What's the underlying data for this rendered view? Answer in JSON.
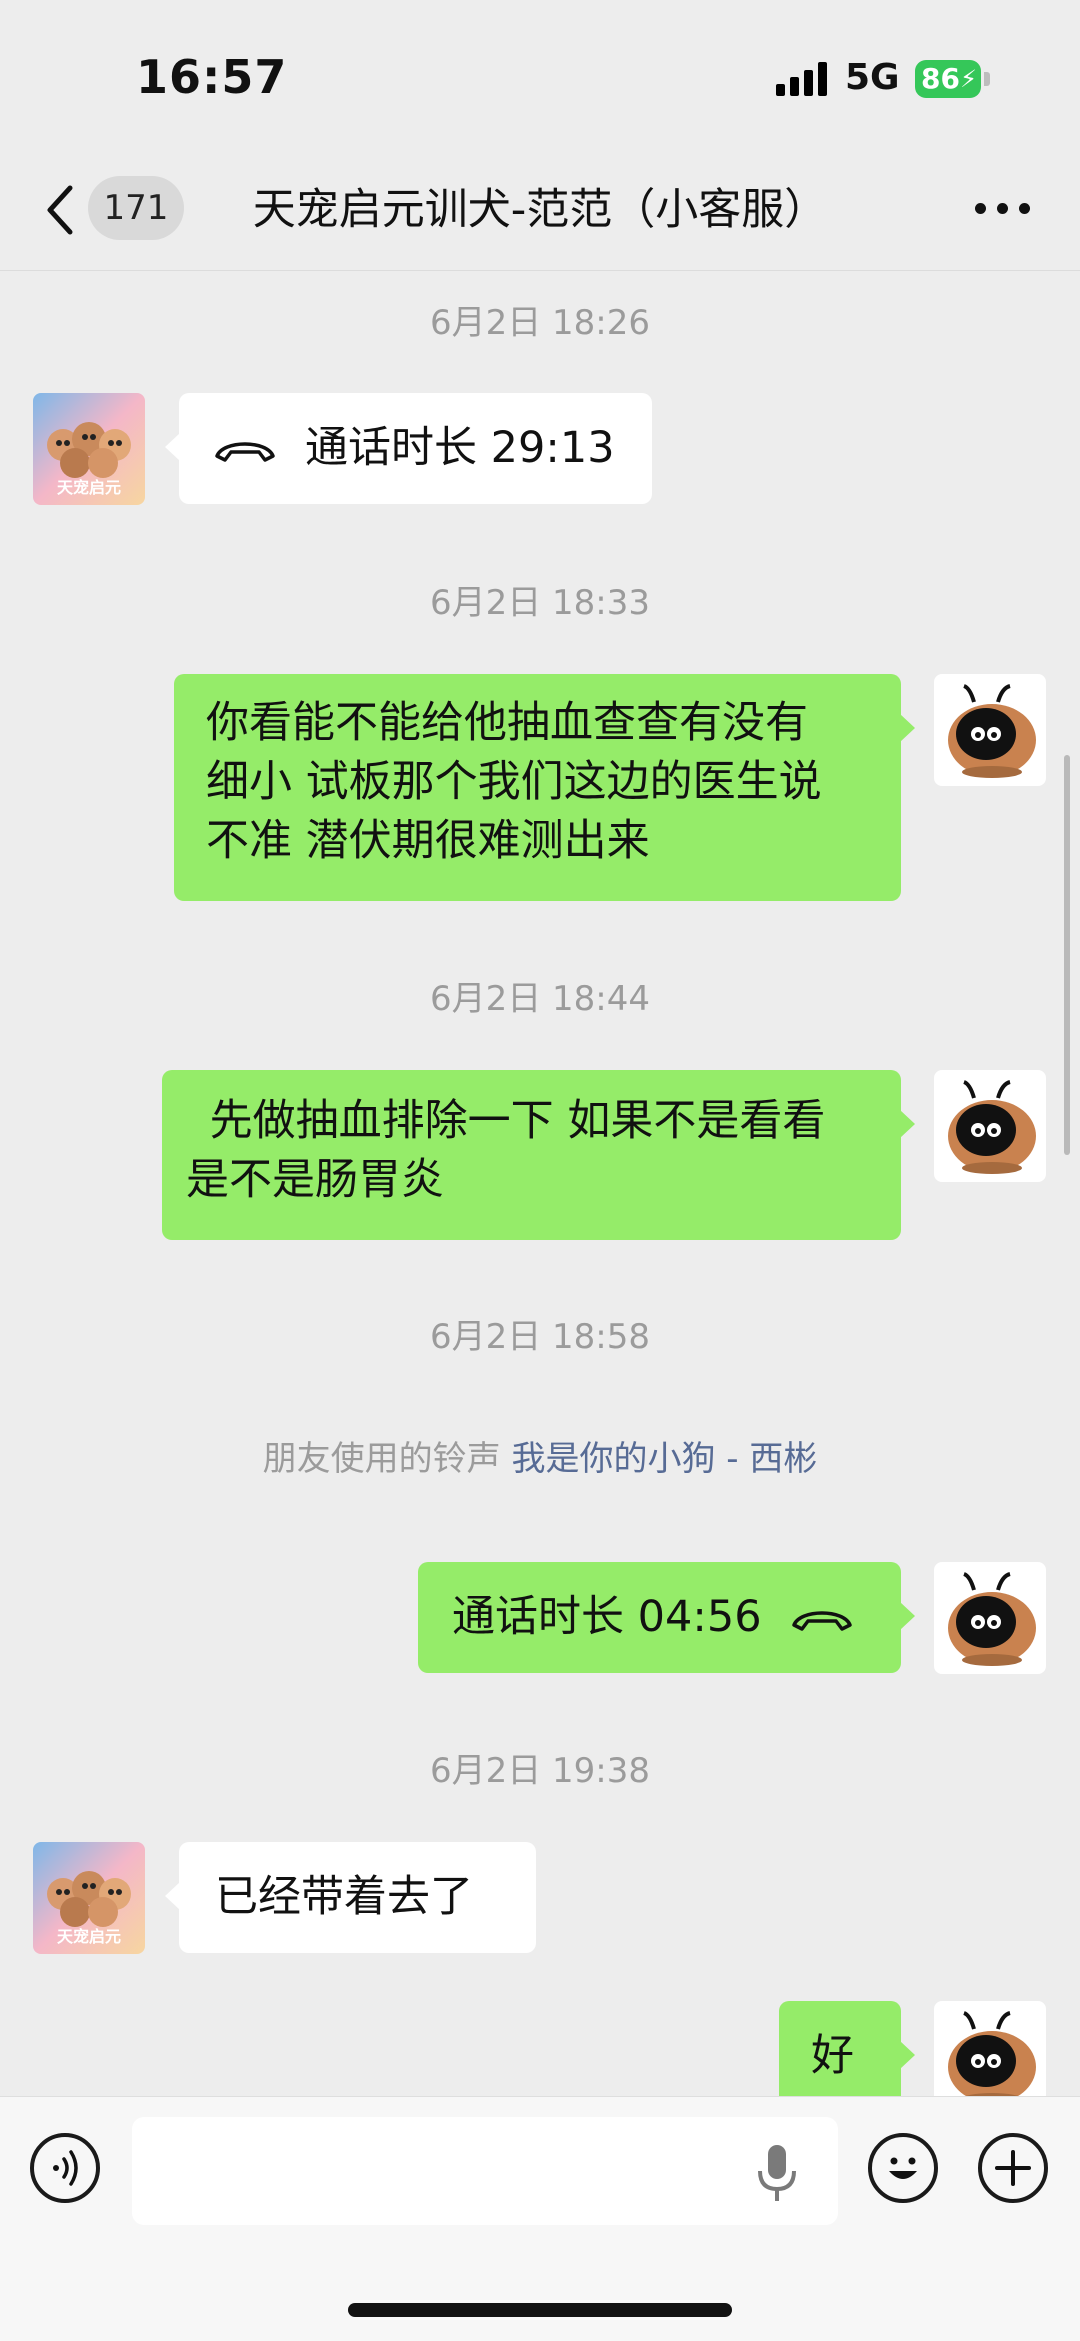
{
  "status_bar": {
    "time": "16:57",
    "network": "5G",
    "battery": "86"
  },
  "nav": {
    "back_count": "171",
    "title": "天宠启元训犬-范范（小客服）"
  },
  "contact_avatar_text": "天宠启元",
  "messages": [
    {
      "type": "timestamp",
      "text": "6月2日 18:26"
    },
    {
      "type": "call",
      "from": "them",
      "text": "通话时长 29:13"
    },
    {
      "type": "timestamp",
      "text": "6月2日 18:33"
    },
    {
      "type": "text",
      "from": "me",
      "lines": [
        "你看能不能给他抽血查查有没有",
        "细小 试板那个我们这边的医生说",
        "不准 潜伏期很难测出来"
      ]
    },
    {
      "type": "timestamp",
      "text": "6月2日 18:44"
    },
    {
      "type": "text",
      "from": "me",
      "lines": [
        " 先做抽血排除一下 如果不是看看",
        "是不是肠胃炎"
      ]
    },
    {
      "type": "timestamp",
      "text": "6月2日 18:58"
    },
    {
      "type": "system",
      "prefix": "朋友使用的铃声",
      "link": "我是你的小狗 - 西彬"
    },
    {
      "type": "call",
      "from": "me",
      "text": "通话时长 04:56"
    },
    {
      "type": "timestamp",
      "text": "6月2日 19:38"
    },
    {
      "type": "text",
      "from": "them",
      "lines": [
        "已经带着去了"
      ]
    },
    {
      "type": "text",
      "from": "me",
      "lines": [
        "好"
      ]
    }
  ],
  "input": {
    "placeholder": ""
  },
  "colors": {
    "outgoing_bubble": "#95ec69",
    "incoming_bubble": "#ffffff",
    "background": "#ededed",
    "link": "#576b95"
  }
}
